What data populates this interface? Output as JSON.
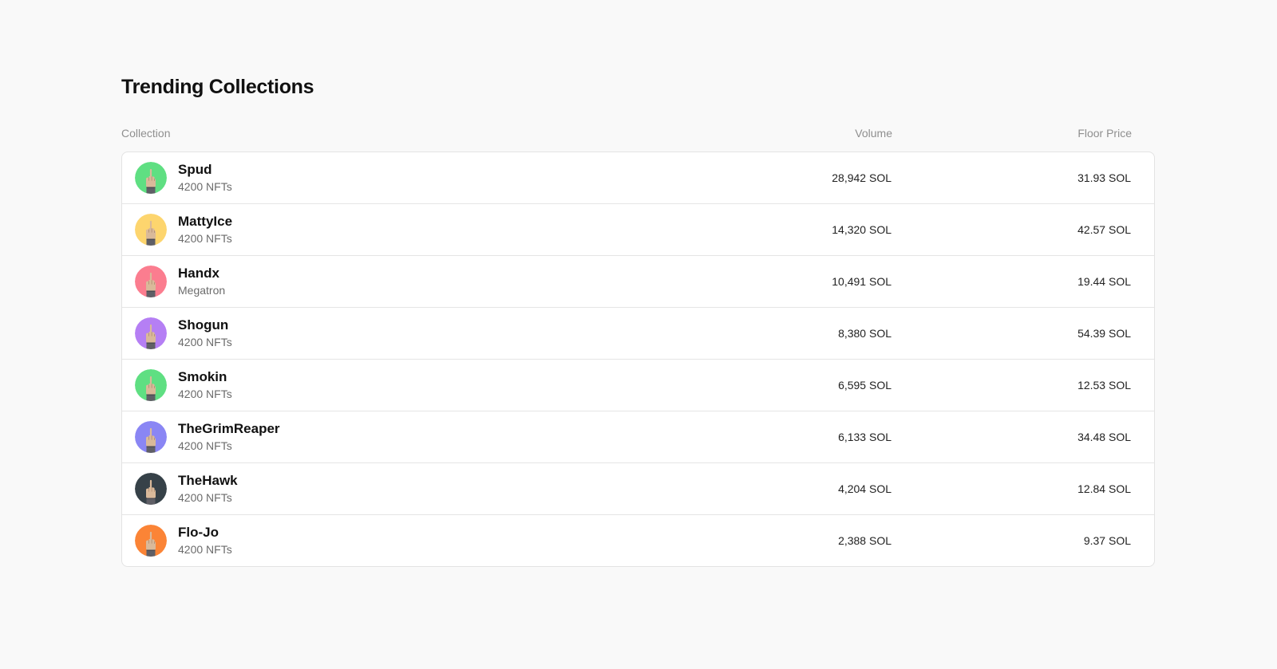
{
  "page": {
    "title": "Trending Collections"
  },
  "table": {
    "headers": {
      "collection": "Collection",
      "volume": "Volume",
      "floor_price": "Floor Price"
    },
    "rows": [
      {
        "name": "Spud",
        "subtitle": "4200 NFTs",
        "volume": "28,942 SOL",
        "floor_price": "31.93 SOL",
        "avatar_color": "#5fdf82",
        "avatar_icon": "hand-icon"
      },
      {
        "name": "MattyIce",
        "subtitle": "4200 NFTs",
        "volume": "14,320 SOL",
        "floor_price": "42.57 SOL",
        "avatar_color": "#fdd56e",
        "avatar_icon": "hand-icon"
      },
      {
        "name": "Handx",
        "subtitle": "Megatron",
        "volume": "10,491 SOL",
        "floor_price": "19.44 SOL",
        "avatar_color": "#fb7d8f",
        "avatar_icon": "hand-icon"
      },
      {
        "name": "Shogun",
        "subtitle": "4200 NFTs",
        "volume": "8,380 SOL",
        "floor_price": "54.39 SOL",
        "avatar_color": "#b57ff4",
        "avatar_icon": "hand-icon"
      },
      {
        "name": "Smokin",
        "subtitle": "4200 NFTs",
        "volume": "6,595 SOL",
        "floor_price": "12.53 SOL",
        "avatar_color": "#5fdf82",
        "avatar_icon": "hand-icon"
      },
      {
        "name": "TheGrimReaper",
        "subtitle": "4200 NFTs",
        "volume": "6,133 SOL",
        "floor_price": "34.48 SOL",
        "avatar_color": "#8a86f4",
        "avatar_icon": "hand-icon"
      },
      {
        "name": "TheHawk",
        "subtitle": "4200 NFTs",
        "volume": "4,204 SOL",
        "floor_price": "12.84 SOL",
        "avatar_color": "#364148",
        "avatar_icon": "hand-icon"
      },
      {
        "name": "Flo-Jo",
        "subtitle": "4200 NFTs",
        "volume": "2,388 SOL",
        "floor_price": "9.37 SOL",
        "avatar_color": "#fb8436",
        "avatar_icon": "hand-icon"
      }
    ]
  }
}
